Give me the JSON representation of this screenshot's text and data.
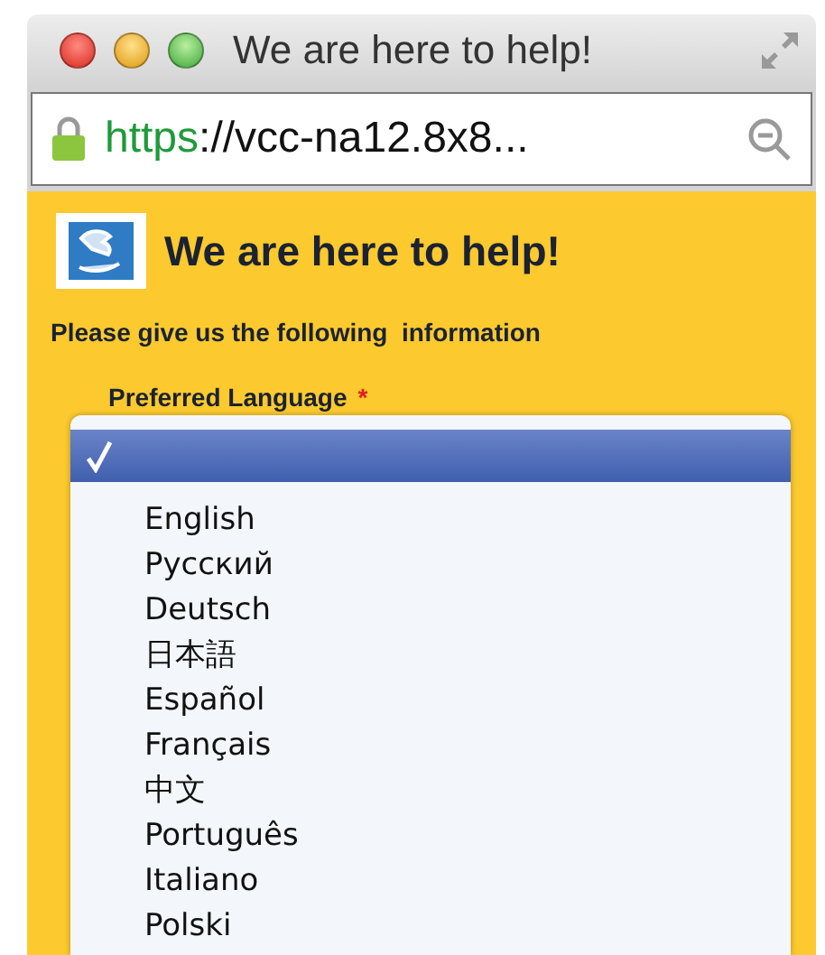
{
  "window": {
    "title": "We are here to help!"
  },
  "address_bar": {
    "scheme": "https",
    "rest": "://vcc-na12.8x8..."
  },
  "page": {
    "heading": "We are here to help!",
    "subtitle": "Please give us the following  information",
    "field_label": "Preferred Language",
    "required_mark": "*"
  },
  "language_menu": [
    {
      "checked": true,
      "selected": true
    },
    {
      "label": "English",
      "checked": false,
      "selected": false
    },
    {
      "label": "Русский",
      "checked": false,
      "selected": false
    },
    {
      "label": "Deutsch",
      "checked": false,
      "selected": false
    },
    {
      "label": "日本語",
      "checked": false,
      "selected": false
    },
    {
      "label": "Español",
      "checked": false,
      "selected": false
    },
    {
      "label": "Français",
      "checked": false,
      "selected": false
    },
    {
      "label": "中文",
      "checked": false,
      "selected": false
    },
    {
      "label": "Português",
      "checked": false,
      "selected": false
    },
    {
      "label": "Italiano",
      "checked": false,
      "selected": false
    },
    {
      "label": "Polski",
      "checked": false,
      "selected": false
    }
  ]
}
